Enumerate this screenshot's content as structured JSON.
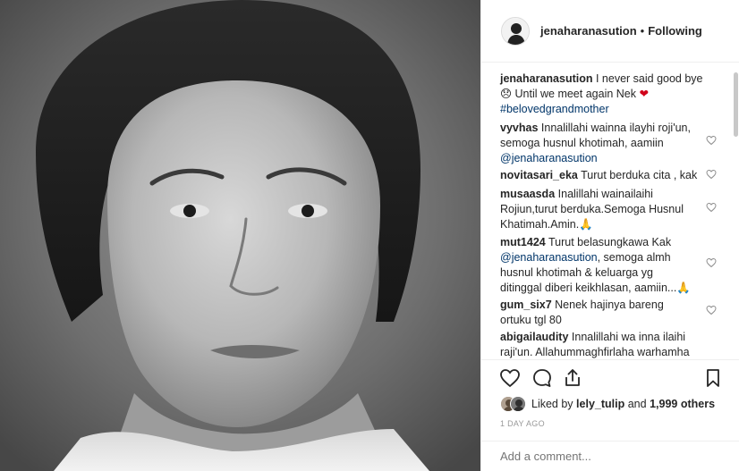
{
  "post": {
    "author": "jenaharanasution",
    "follow_status": "Following",
    "separator": "•",
    "caption": {
      "username": "jenaharanasution",
      "text_line1": "I never said good bye",
      "emoji_sad": "😞",
      "text_line2": "Until we meet again Nek",
      "emoji_heart": "❤",
      "hashtag": "#belovedgrandmother"
    },
    "comments": [
      {
        "username": "vyvhas",
        "parts": [
          "Innalillahi wainna ilayhi roji'un,",
          "semoga husnul khotimah, aamiin"
        ],
        "mention": "@jenaharanasution"
      },
      {
        "username": "novitasari_eka",
        "parts": [
          "Turut berduka cita , kak"
        ]
      },
      {
        "username": "musaasda",
        "parts": [
          "Inalillahi wainailaihi",
          "Rojiun,turut berduka.Semoga Husnul",
          "Khatimah.Amin."
        ],
        "emoji": "🙏"
      },
      {
        "username": "mut1424",
        "parts": [
          "Turut belasungkawa Kak"
        ],
        "mention": "@jenaharanasution",
        "after_mention": ", semoga almh",
        "rest": [
          "husnul khotimah & keluarga yg",
          "ditinggal diberi keikhlasan, aamiin..."
        ],
        "emoji": "🙏"
      },
      {
        "username": "gum_six7",
        "parts": [
          "Nenek hajinya bareng",
          "ortuku tgl 80"
        ]
      },
      {
        "username": "abigailaudity",
        "parts": [
          "Innalillahi wa inna ilaihi",
          "raji'un. Allahummaghfirlaha warhamha"
        ]
      }
    ],
    "likes": {
      "prefix": "Liked by",
      "user": "lely_tulip",
      "middle": "and",
      "count_text": "1,999 others"
    },
    "time": "1 DAY AGO",
    "add_comment_placeholder": "Add a comment..."
  },
  "icons": {
    "like": "heart-outline-icon",
    "comment": "comment-bubble-icon",
    "share": "share-icon",
    "save": "bookmark-icon",
    "comment_like": "heart-outline-icon"
  },
  "colors": {
    "text": "#262626",
    "muted": "#999999",
    "link": "#003569",
    "border": "#efefef"
  }
}
